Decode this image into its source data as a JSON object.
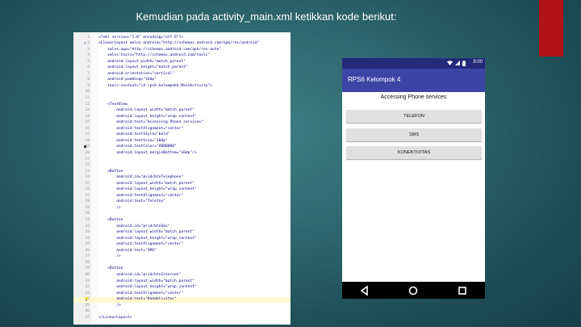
{
  "slide": {
    "title": "Kemudian pada activity_main.xml ketikkan kode berikut:"
  },
  "colors": {
    "accent_red": "#b01217",
    "app_bar": "#3c45a5",
    "status_bar": "#25297a",
    "button_bg": "#e0e0e0"
  },
  "editor": {
    "lines": [
      {
        "n": "1",
        "t": "<?xml version=\"1.0\" encoding=\"utf-8\"?>"
      },
      {
        "n": "2",
        "t": "<LinearLayout xmlns:android=\"http://schemas.android.com/apk/res/android\"",
        "marker": "c"
      },
      {
        "n": "3",
        "t": "    xmlns:app=\"http://schemas.android.com/apk/res-auto\""
      },
      {
        "n": "4",
        "t": "    xmlns:tools=\"http://schemas.android.com/tools\""
      },
      {
        "n": "5",
        "t": "    android:layout_width=\"match_parent\""
      },
      {
        "n": "6",
        "t": "    android:layout_height=\"match_parent\""
      },
      {
        "n": "7",
        "t": "    android:orientation=\"vertical\""
      },
      {
        "n": "8",
        "t": "    android:padding=\"16dp\""
      },
      {
        "n": "9",
        "t": "    tools:context=\"id.rps6.kelompok4.MainActivity\">"
      },
      {
        "n": "10",
        "t": ""
      },
      {
        "n": "11",
        "t": ""
      },
      {
        "n": "12",
        "t": "    <TextView"
      },
      {
        "n": "13",
        "t": "        android:layout_width=\"match_parent\""
      },
      {
        "n": "14",
        "t": "        android:layout_height=\"wrap_content\""
      },
      {
        "n": "15",
        "t": "        android:text=\"Accessing Phone services\""
      },
      {
        "n": "16",
        "t": "        android:textAlignment=\"center\""
      },
      {
        "n": "17",
        "t": "        android:textStyle=\"bold\""
      },
      {
        "n": "18",
        "t": "        android:textSize=\"18dp\""
      },
      {
        "n": "19",
        "t": "        android:textColor=\"#000000\"",
        "marker": "■"
      },
      {
        "n": "20",
        "t": "        android:layout_marginBottom=\"16dp\"/>"
      },
      {
        "n": "21",
        "t": ""
      },
      {
        "n": "22",
        "t": ""
      },
      {
        "n": "23",
        "t": "    <Button"
      },
      {
        "n": "24",
        "t": "        android:id=\"@+id/btnTelephone\""
      },
      {
        "n": "25",
        "t": "        android:layout_width=\"match_parent\""
      },
      {
        "n": "26",
        "t": "        android:layout_height=\"wrap_content\""
      },
      {
        "n": "27",
        "t": "        android:textAlignment=\"center\""
      },
      {
        "n": "28",
        "t": "        android:text=\"Telefon\""
      },
      {
        "n": "29",
        "t": "        />"
      },
      {
        "n": "30",
        "t": ""
      },
      {
        "n": "31",
        "t": "    <Button"
      },
      {
        "n": "32",
        "t": "        android:id=\"@+id/btnSms\""
      },
      {
        "n": "33",
        "t": "        android:layout_width=\"match_parent\""
      },
      {
        "n": "34",
        "t": "        android:layout_height=\"wrap_content\""
      },
      {
        "n": "35",
        "t": "        android:textAlignment=\"center\""
      },
      {
        "n": "36",
        "t": "        android:text=\"SMS\""
      },
      {
        "n": "37",
        "t": "        />"
      },
      {
        "n": "38",
        "t": ""
      },
      {
        "n": "39",
        "t": "    <Button"
      },
      {
        "n": "40",
        "t": "        android:id=\"@+id/btnInternet\""
      },
      {
        "n": "41",
        "t": "        android:layout_width=\"match_parent\""
      },
      {
        "n": "42",
        "t": "        android:layout_height=\"wrap_content\""
      },
      {
        "n": "43",
        "t": "        android:textAlignment=\"center\""
      },
      {
        "n": "44",
        "t": "        android:text=\"Konektivitas\"",
        "marker": "💡",
        "highlight": true
      },
      {
        "n": "45",
        "t": "        />"
      },
      {
        "n": "46",
        "t": ""
      },
      {
        "n": "47",
        "t": "</LinearLayout>"
      }
    ]
  },
  "phone": {
    "status_time": "8:00",
    "app_title": "RPS6 Kelompok 4",
    "heading": "Accessing Phone services",
    "buttons": {
      "telefon": "TELEFON",
      "sms": "SMS",
      "konektivitas": "KONEKTIVITAS"
    },
    "nav": {
      "back_icon": "back-triangle-icon",
      "home_icon": "home-circle-icon",
      "recents_icon": "recents-square-icon"
    }
  }
}
